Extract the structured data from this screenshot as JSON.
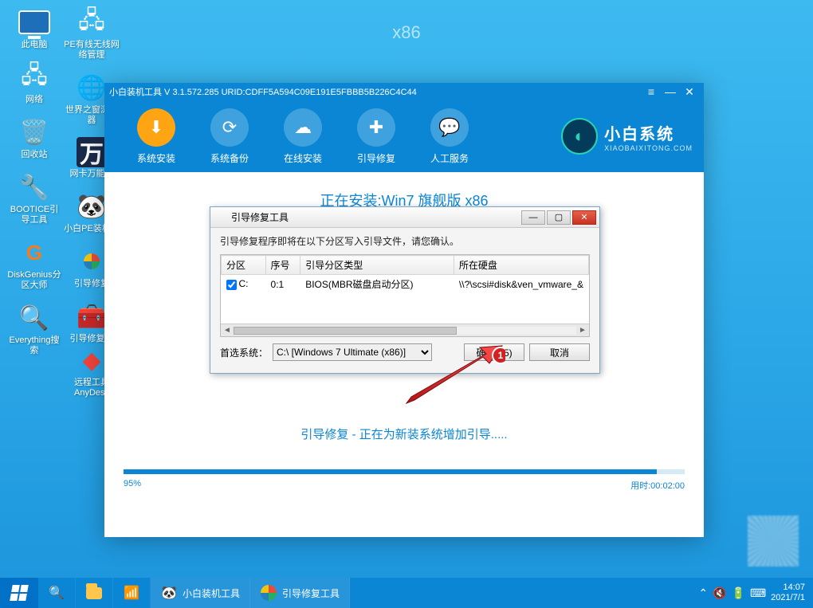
{
  "desktop_label": "x86",
  "desktop_icons": {
    "col1": [
      {
        "name": "this-pc",
        "label": "此电脑"
      },
      {
        "name": "network",
        "label": "网络"
      },
      {
        "name": "recycle-bin",
        "label": "回收站"
      },
      {
        "name": "bootice",
        "label": "BOOTICE引导工具"
      },
      {
        "name": "diskgenius",
        "label": "DiskGenius分区大师"
      },
      {
        "name": "everything",
        "label": "Everything搜索"
      }
    ],
    "col2": [
      {
        "name": "pe-net",
        "label": "PE有线无线网络管理"
      },
      {
        "name": "world-browser",
        "label": "世界之窗浏览器"
      },
      {
        "name": "net-driver",
        "label": "网卡万能驱"
      },
      {
        "name": "xiaobai-pe",
        "label": "小白PE装机具"
      },
      {
        "name": "boot-repair",
        "label": "引导修复"
      },
      {
        "name": "boot-repair-tool",
        "label": "引导修复工"
      }
    ],
    "col3": [
      {
        "name": "anydesk",
        "label": "远程工具AnyDesk"
      }
    ]
  },
  "main_window": {
    "title": "小白装机工具 V 3.1.572.285 URID:CDFF5A594C09E191E5FBBB5B226C4C44",
    "toolbar": [
      {
        "name": "sys-install",
        "label": "系统安装",
        "active": true
      },
      {
        "name": "sys-backup",
        "label": "系统备份",
        "active": false
      },
      {
        "name": "online-install",
        "label": "在线安装",
        "active": false
      },
      {
        "name": "boot-repair",
        "label": "引导修复",
        "active": false
      },
      {
        "name": "manual-service",
        "label": "人工服务",
        "active": false
      }
    ],
    "brand_title": "小白系统",
    "brand_sub": "XIAOBAIXITONG.COM",
    "installing_title": "正在安装:Win7 旗舰版 x86",
    "boot_status": "引导修复 - 正在为新装系统增加引导.....",
    "progress_pct_label": "95%",
    "progress_time_label": "用时:00:02:00",
    "progress_pct": 95
  },
  "dialog": {
    "title": "引导修复工具",
    "message": "引导修复程序即将在以下分区写入引导文件，请您确认。",
    "headers": {
      "partition": "分区",
      "index": "序号",
      "type": "引导分区类型",
      "disk": "所在硬盘"
    },
    "rows": [
      {
        "checked": true,
        "partition": "C:",
        "index": "0:1",
        "type": "BIOS(MBR磁盘启动分区)",
        "disk": "\\\\?\\scsi#disk&ven_vmware_&"
      }
    ],
    "footer_label": "首选系统：",
    "select_value": "C:\\ [Windows 7 Ultimate (x86)]",
    "ok_label": "确定(15)",
    "cancel_label": "取消"
  },
  "taskbar": {
    "item1": "小白装机工具",
    "item2": "引导修复工具",
    "time": "14:07",
    "date": "2021/7/1"
  },
  "annotation": {
    "badge": "1"
  }
}
